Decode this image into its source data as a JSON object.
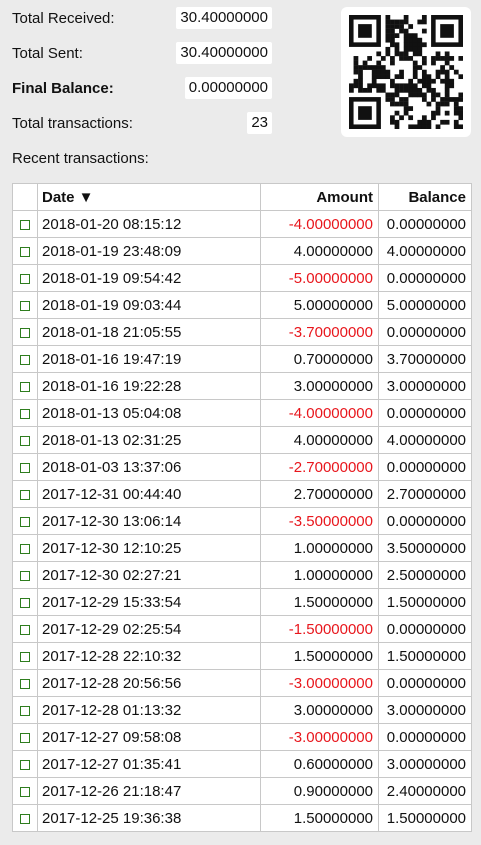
{
  "summary": {
    "total_received_label": "Total Received:",
    "total_received_value": "30.40000000",
    "total_sent_label": "Total Sent:",
    "total_sent_value": "30.40000000",
    "final_balance_label": "Final Balance:",
    "final_balance_value": "0.00000000",
    "total_transactions_label": "Total transactions:",
    "total_transactions_value": "23"
  },
  "recent_label": "Recent transactions:",
  "table": {
    "headers": {
      "date": "Date ▼",
      "amount": "Amount",
      "balance": "Balance"
    },
    "rows": [
      {
        "date": "2018-01-20 08:15:12",
        "amount": "-4.00000000",
        "balance": "0.00000000"
      },
      {
        "date": "2018-01-19 23:48:09",
        "amount": "4.00000000",
        "balance": "4.00000000"
      },
      {
        "date": "2018-01-19 09:54:42",
        "amount": "-5.00000000",
        "balance": "0.00000000"
      },
      {
        "date": "2018-01-19 09:03:44",
        "amount": "5.00000000",
        "balance": "5.00000000"
      },
      {
        "date": "2018-01-18 21:05:55",
        "amount": "-3.70000000",
        "balance": "0.00000000"
      },
      {
        "date": "2018-01-16 19:47:19",
        "amount": "0.70000000",
        "balance": "3.70000000"
      },
      {
        "date": "2018-01-16 19:22:28",
        "amount": "3.00000000",
        "balance": "3.00000000"
      },
      {
        "date": "2018-01-13 05:04:08",
        "amount": "-4.00000000",
        "balance": "0.00000000"
      },
      {
        "date": "2018-01-13 02:31:25",
        "amount": "4.00000000",
        "balance": "4.00000000"
      },
      {
        "date": "2018-01-03 13:37:06",
        "amount": "-2.70000000",
        "balance": "0.00000000"
      },
      {
        "date": "2017-12-31 00:44:40",
        "amount": "2.70000000",
        "balance": "2.70000000"
      },
      {
        "date": "2017-12-30 13:06:14",
        "amount": "-3.50000000",
        "balance": "0.00000000"
      },
      {
        "date": "2017-12-30 12:10:25",
        "amount": "1.00000000",
        "balance": "3.50000000"
      },
      {
        "date": "2017-12-30 02:27:21",
        "amount": "1.00000000",
        "balance": "2.50000000"
      },
      {
        "date": "2017-12-29 15:33:54",
        "amount": "1.50000000",
        "balance": "1.50000000"
      },
      {
        "date": "2017-12-29 02:25:54",
        "amount": "-1.50000000",
        "balance": "0.00000000"
      },
      {
        "date": "2017-12-28 22:10:32",
        "amount": "1.50000000",
        "balance": "1.50000000"
      },
      {
        "date": "2017-12-28 20:56:56",
        "amount": "-3.00000000",
        "balance": "0.00000000"
      },
      {
        "date": "2017-12-28 01:13:32",
        "amount": "3.00000000",
        "balance": "3.00000000"
      },
      {
        "date": "2017-12-27 09:58:08",
        "amount": "-3.00000000",
        "balance": "0.00000000"
      },
      {
        "date": "2017-12-27 01:35:41",
        "amount": "0.60000000",
        "balance": "3.00000000"
      },
      {
        "date": "2017-12-26 21:18:47",
        "amount": "0.90000000",
        "balance": "2.40000000"
      },
      {
        "date": "2017-12-25 19:36:38",
        "amount": "1.50000000",
        "balance": "1.50000000"
      }
    ]
  },
  "colors": {
    "background": "#ebebeb",
    "negative_amount": "#e8161c",
    "checkbox": "#2e7d1e",
    "grid": "#c8c8c8"
  },
  "icons": {
    "qr": "qr-code-icon",
    "row_marker": "checkbox-icon"
  }
}
